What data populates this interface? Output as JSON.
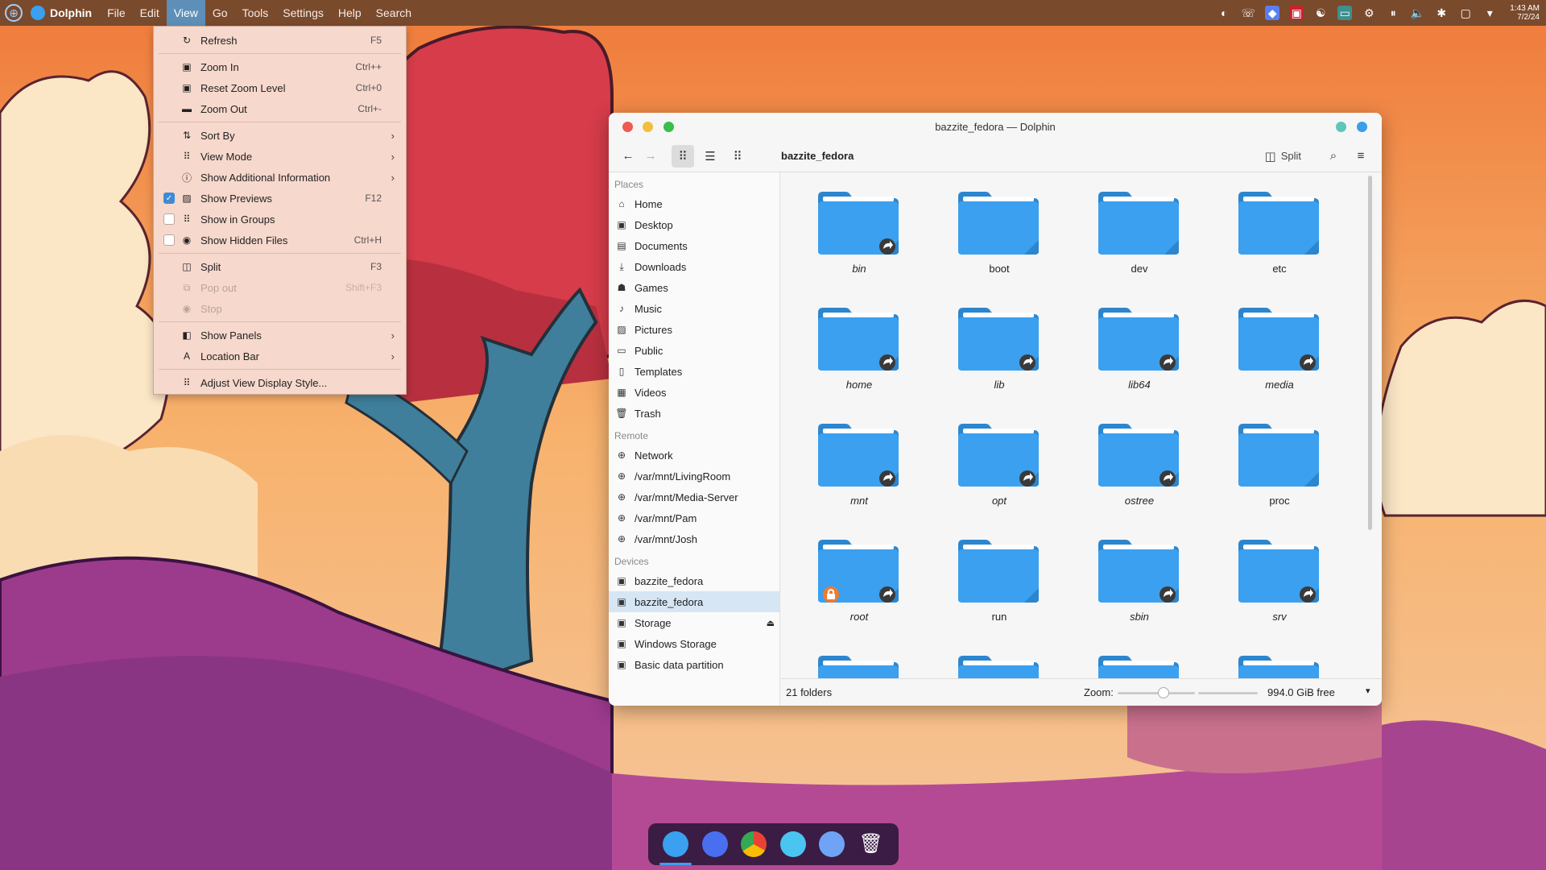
{
  "topbar": {
    "app_name": "Dolphin",
    "menus": [
      "File",
      "Edit",
      "View",
      "Go",
      "Tools",
      "Settings",
      "Help",
      "Search"
    ],
    "active_menu": "View",
    "clock_time": "1:43 AM",
    "clock_date": "7/2/24"
  },
  "view_menu": {
    "refresh": {
      "label": "Refresh",
      "shortcut": "F5"
    },
    "zoom_in": {
      "label": "Zoom In",
      "shortcut": "Ctrl++"
    },
    "reset_zoom": {
      "label": "Reset Zoom Level",
      "shortcut": "Ctrl+0"
    },
    "zoom_out": {
      "label": "Zoom Out",
      "shortcut": "Ctrl+-"
    },
    "sort_by": {
      "label": "Sort By"
    },
    "view_mode": {
      "label": "View Mode"
    },
    "show_additional": {
      "label": "Show Additional Information"
    },
    "show_previews": {
      "label": "Show Previews",
      "shortcut": "F12",
      "checked": true
    },
    "show_in_groups": {
      "label": "Show in Groups",
      "checked": false
    },
    "show_hidden": {
      "label": "Show Hidden Files",
      "shortcut": "Ctrl+H",
      "checked": false
    },
    "split": {
      "label": "Split",
      "shortcut": "F3"
    },
    "pop_out": {
      "label": "Pop out",
      "shortcut": "Shift+F3",
      "disabled": true
    },
    "stop": {
      "label": "Stop",
      "disabled": true
    },
    "show_panels": {
      "label": "Show Panels"
    },
    "location_bar": {
      "label": "Location Bar"
    },
    "adjust_view": {
      "label": "Adjust View Display Style..."
    }
  },
  "window": {
    "title": "bazzite_fedora — Dolphin",
    "path": "bazzite_fedora",
    "split_label": "Split"
  },
  "sidebar": {
    "places_title": "Places",
    "places": [
      "Home",
      "Desktop",
      "Documents",
      "Downloads",
      "Games",
      "Music",
      "Pictures",
      "Public",
      "Templates",
      "Videos",
      "Trash"
    ],
    "remote_title": "Remote",
    "remote": [
      "Network",
      "/var/mnt/LivingRoom",
      "/var/mnt/Media-Server",
      "/var/mnt/Pam",
      "/var/mnt/Josh"
    ],
    "devices_title": "Devices",
    "devices": [
      "bazzite_fedora",
      "bazzite_fedora",
      "Storage",
      "Windows Storage",
      "Basic data partition"
    ]
  },
  "folders": [
    {
      "name": "bin",
      "link": true
    },
    {
      "name": "boot",
      "link": false
    },
    {
      "name": "dev",
      "link": false
    },
    {
      "name": "etc",
      "link": false
    },
    {
      "name": "home",
      "link": true
    },
    {
      "name": "lib",
      "link": true
    },
    {
      "name": "lib64",
      "link": true
    },
    {
      "name": "media",
      "link": true
    },
    {
      "name": "mnt",
      "link": true
    },
    {
      "name": "opt",
      "link": true
    },
    {
      "name": "ostree",
      "link": true
    },
    {
      "name": "proc",
      "link": false
    },
    {
      "name": "root",
      "link": true,
      "locked": true
    },
    {
      "name": "run",
      "link": false
    },
    {
      "name": "sbin",
      "link": true
    },
    {
      "name": "srv",
      "link": true
    }
  ],
  "status": {
    "count": "21 folders",
    "zoom_label": "Zoom:",
    "free": "994.0 GiB free"
  },
  "colors": {
    "folder": "#3aa0ef",
    "folder_dark": "#2b86cf",
    "accent": "#3d8bd8"
  }
}
